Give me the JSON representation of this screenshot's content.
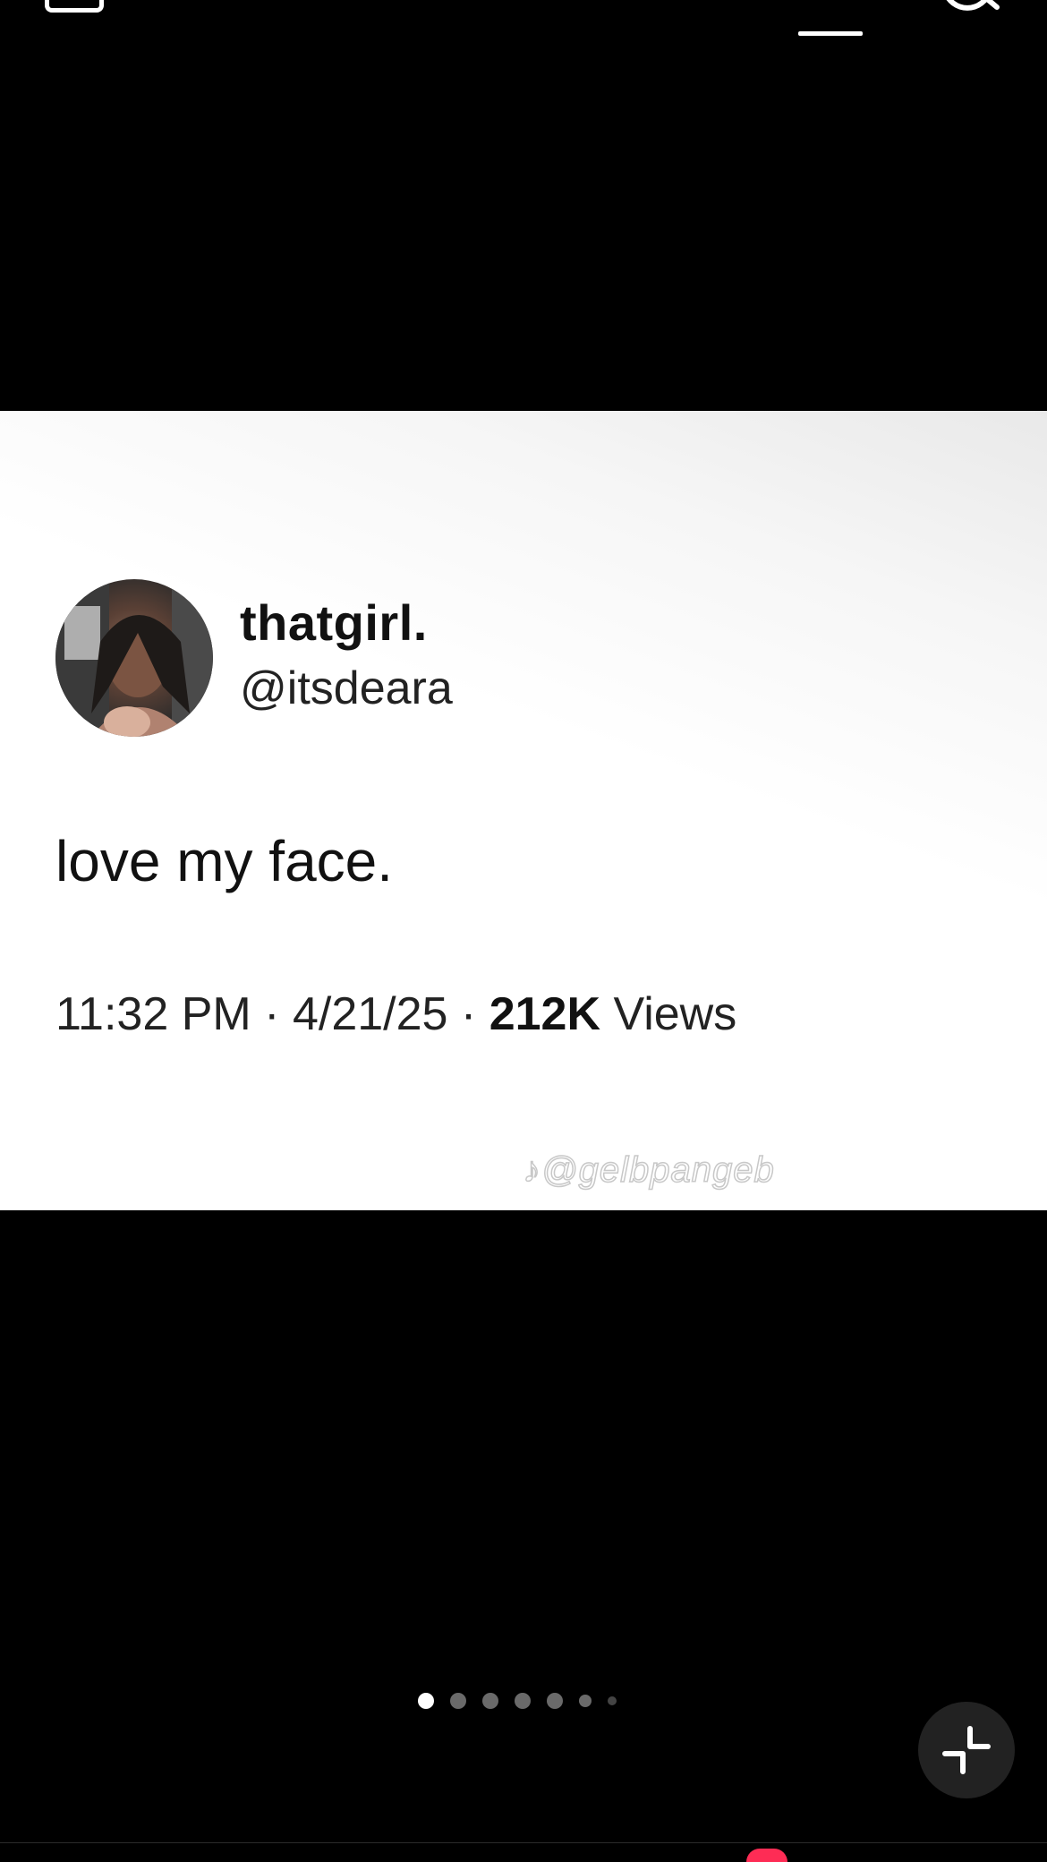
{
  "post": {
    "display_name": "thatgirl.",
    "handle": "@itsdeara",
    "text": "love my face.",
    "time": "11:32 PM",
    "date": "4/21/25",
    "separator": "·",
    "views_count": "212K",
    "views_label": "Views",
    "watermark": "♪@gelbpangeb"
  },
  "carousel": {
    "total_dots": 7,
    "active_index": 0
  },
  "icons": {
    "inbox": "inbox-icon",
    "search": "search-icon",
    "collapse": "collapse-icon"
  },
  "colors": {
    "background": "#000000",
    "card": "#ffffff",
    "badge": "#fe2c55"
  }
}
